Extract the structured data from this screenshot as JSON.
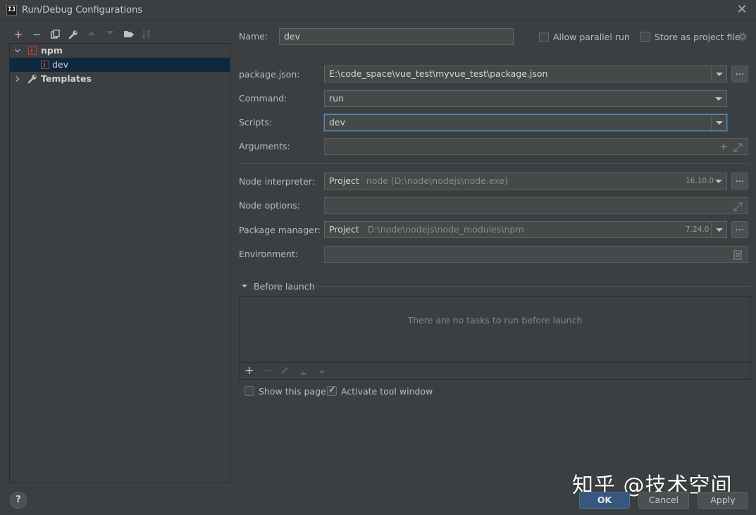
{
  "window": {
    "title": "Run/Debug Configurations",
    "app_icon_label": "IJ"
  },
  "tree": {
    "items": [
      {
        "label": "npm",
        "icon": "npm-icon",
        "expanded": true
      },
      {
        "label": "dev",
        "icon": "npm-icon",
        "selected": true
      },
      {
        "label": "Templates",
        "icon": "wrench-icon",
        "expanded": false
      }
    ]
  },
  "form": {
    "name_label": "Name:",
    "name_value": "dev",
    "allow_parallel_label": "Allow parallel run",
    "allow_parallel_checked": false,
    "store_project_label": "Store as project file",
    "store_project_checked": false,
    "package_json_label": "package.json:",
    "package_json_value": "E:\\code_space\\vue_test\\myvue_test\\package.json",
    "command_label": "Command:",
    "command_value": "run",
    "scripts_label": "Scripts:",
    "scripts_value": "dev",
    "arguments_label": "Arguments:",
    "arguments_value": "",
    "node_interpreter_label": "Node interpreter:",
    "node_interpreter_prefix": "Project",
    "node_interpreter_path": "node (D:\\node\\nodejs\\node.exe)",
    "node_interpreter_version": "16.10.0",
    "node_options_label": "Node options:",
    "node_options_value": "",
    "package_manager_label": "Package manager:",
    "package_manager_prefix": "Project",
    "package_manager_path": "D:\\node\\nodejs\\node_modules\\npm",
    "package_manager_version": "7.24.0",
    "environment_label": "Environment:",
    "environment_value": "",
    "browse_label": "..."
  },
  "before_launch": {
    "title": "Before launch",
    "empty_text": "There are no tasks to run before launch"
  },
  "options": {
    "show_page_label": "Show this page",
    "show_page_checked": false,
    "activate_tool_label": "Activate tool window",
    "activate_tool_checked": true
  },
  "buttons": {
    "ok": "OK",
    "cancel": "Cancel",
    "apply": "Apply",
    "help": "?"
  },
  "watermark": "知乎 @技术空间",
  "colors": {
    "accent": "#365880",
    "selection": "#0d293e",
    "npm_red": "#cb3837"
  }
}
